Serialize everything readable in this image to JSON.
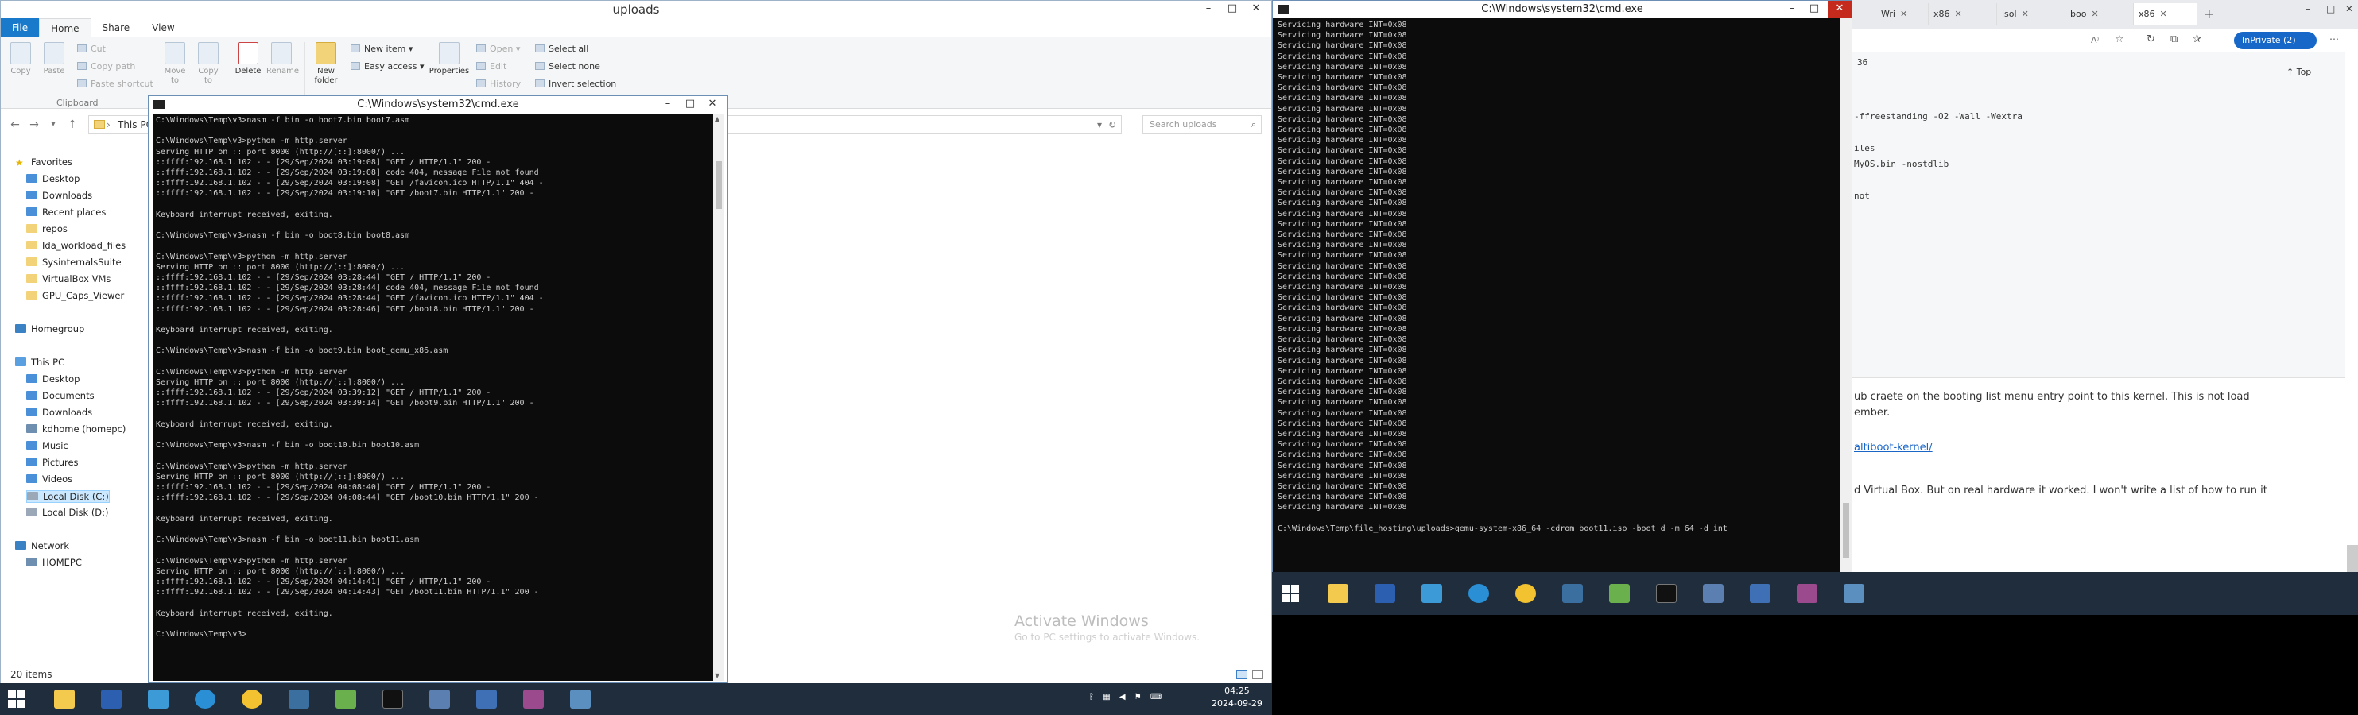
{
  "explorer": {
    "title": "uploads",
    "tabs": [
      "File",
      "Home",
      "Share",
      "View"
    ],
    "ribbon": {
      "clipboard": {
        "copy": "Copy",
        "paste": "Paste",
        "cut": "Cut",
        "copy_path": "Copy path",
        "paste_shortcut": "Paste shortcut",
        "group": "Clipboard"
      },
      "organize": {
        "move_to": "Move to",
        "copy_to": "Copy to",
        "delete": "Delete",
        "rename": "Rename"
      },
      "new": {
        "new_folder": "New folder",
        "new_item": "New item",
        "easy_access": "Easy access"
      },
      "open": {
        "properties": "Properties",
        "open": "Open",
        "edit": "Edit",
        "history": "History"
      },
      "select": {
        "select_all": "Select all",
        "select_none": "Select none",
        "invert": "Invert selection"
      }
    },
    "address": "This PC",
    "search_placeholder": "Search uploads",
    "nav": {
      "favorites": "Favorites",
      "fav_items": [
        "Desktop",
        "Downloads",
        "Recent places",
        "repos",
        "Ida_workload_files",
        "SysinternalsSuite",
        "VirtualBox VMs",
        "GPU_Caps_Viewer"
      ],
      "homegroup": "Homegroup",
      "this_pc": "This PC",
      "pc_items": [
        "Desktop",
        "Documents",
        "Downloads",
        "kdhome (homepc)",
        "Music",
        "Pictures",
        "Videos",
        "Local Disk (C:)",
        "Local Disk (D:)"
      ],
      "network": "Network",
      "net_items": [
        "HOMEPC"
      ]
    },
    "status": "20 items",
    "watermark_title": "Activate Windows",
    "watermark_sub": "Go to PC settings to activate Windows."
  },
  "cmd1": {
    "title": "C:\\Windows\\system32\\cmd.exe",
    "lines": [
      "C:\\Windows\\Temp\\v3>nasm -f bin -o boot7.bin boot7.asm",
      "",
      "C:\\Windows\\Temp\\v3>python -m http.server",
      "Serving HTTP on :: port 8000 (http://[::]:8000/) ...",
      "::ffff:192.168.1.102 - - [29/Sep/2024 03:19:08] \"GET / HTTP/1.1\" 200 -",
      "::ffff:192.168.1.102 - - [29/Sep/2024 03:19:08] code 404, message File not found",
      "::ffff:192.168.1.102 - - [29/Sep/2024 03:19:08] \"GET /favicon.ico HTTP/1.1\" 404 -",
      "::ffff:192.168.1.102 - - [29/Sep/2024 03:19:10] \"GET /boot7.bin HTTP/1.1\" 200 -",
      "",
      "Keyboard interrupt received, exiting.",
      "",
      "C:\\Windows\\Temp\\v3>nasm -f bin -o boot8.bin boot8.asm",
      "",
      "C:\\Windows\\Temp\\v3>python -m http.server",
      "Serving HTTP on :: port 8000 (http://[::]:8000/) ...",
      "::ffff:192.168.1.102 - - [29/Sep/2024 03:28:44] \"GET / HTTP/1.1\" 200 -",
      "::ffff:192.168.1.102 - - [29/Sep/2024 03:28:44] code 404, message File not found",
      "::ffff:192.168.1.102 - - [29/Sep/2024 03:28:44] \"GET /favicon.ico HTTP/1.1\" 404 -",
      "::ffff:192.168.1.102 - - [29/Sep/2024 03:28:46] \"GET /boot8.bin HTTP/1.1\" 200 -",
      "",
      "Keyboard interrupt received, exiting.",
      "",
      "C:\\Windows\\Temp\\v3>nasm -f bin -o boot9.bin boot_qemu_x86.asm",
      "",
      "C:\\Windows\\Temp\\v3>python -m http.server",
      "Serving HTTP on :: port 8000 (http://[::]:8000/) ...",
      "::ffff:192.168.1.102 - - [29/Sep/2024 03:39:12] \"GET / HTTP/1.1\" 200 -",
      "::ffff:192.168.1.102 - - [29/Sep/2024 03:39:14] \"GET /boot9.bin HTTP/1.1\" 200 -",
      "",
      "Keyboard interrupt received, exiting.",
      "",
      "C:\\Windows\\Temp\\v3>nasm -f bin -o boot10.bin boot10.asm",
      "",
      "C:\\Windows\\Temp\\v3>python -m http.server",
      "Serving HTTP on :: port 8000 (http://[::]:8000/) ...",
      "::ffff:192.168.1.102 - - [29/Sep/2024 04:08:40] \"GET / HTTP/1.1\" 200 -",
      "::ffff:192.168.1.102 - - [29/Sep/2024 04:08:44] \"GET /boot10.bin HTTP/1.1\" 200 -",
      "",
      "Keyboard interrupt received, exiting.",
      "",
      "C:\\Windows\\Temp\\v3>nasm -f bin -o boot11.bin boot11.asm",
      "",
      "C:\\Windows\\Temp\\v3>python -m http.server",
      "Serving HTTP on :: port 8000 (http://[::]:8000/) ...",
      "::ffff:192.168.1.102 - - [29/Sep/2024 04:14:41] \"GET / HTTP/1.1\" 200 -",
      "::ffff:192.168.1.102 - - [29/Sep/2024 04:14:43] \"GET /boot11.bin HTTP/1.1\" 200 -",
      "",
      "Keyboard interrupt received, exiting.",
      "",
      "C:\\Windows\\Temp\\v3>"
    ]
  },
  "cmd2": {
    "title": "C:\\Windows\\system32\\cmd.exe",
    "repeat_line": "Servicing hardware INT=0x08",
    "repeat_count": 47,
    "prompt": "C:\\Windows\\Temp\\file_hosting\\uploads>qemu-system-x86_64 -cdrom boot11.iso -boot d -m 64 -d int"
  },
  "browser": {
    "tabs": [
      "Wri",
      "x86",
      "isol",
      "boo",
      "x86"
    ],
    "profile": "InPrivate (2)",
    "top_link": "Top",
    "lines": [
      "-ffreestanding -O2 -Wall -Wextra",
      "iles",
      "MyOS.bin -nostdlib",
      "not"
    ],
    "para1": "ub craete on the booting list menu entry point to this kernel. This is not load",
    "para1b": "ember.",
    "link": "altiboot-kernel/",
    "para2": "d Virtual Box. But on real hardware it worked. I won't write a list of how to run it",
    "counter": "36"
  },
  "taskbar": {
    "time": "04:25",
    "date": "2024-09-29",
    "icon_names": [
      "start-icon",
      "file-explorer-icon",
      "visual-studio-icon",
      "network-icon",
      "edge-icon",
      "chrome-icon",
      "python-icon",
      "notepadpp-icon",
      "cmd-icon",
      "control-panel-icon",
      "virtualbox-icon",
      "winrar-icon",
      "remote-desktop-icon"
    ]
  },
  "colors": {
    "accent": "#1979ca",
    "cmd_bg": "#0c0c0c",
    "taskbar": "#1f2d3d"
  }
}
